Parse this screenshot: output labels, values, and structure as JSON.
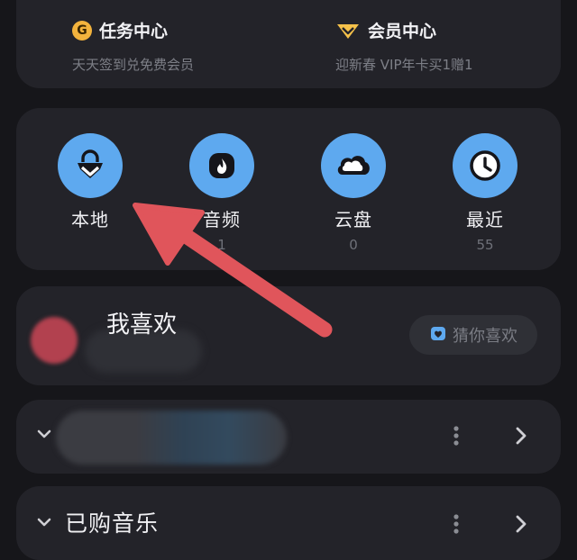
{
  "promos": [
    {
      "icon": "g-coin-icon",
      "title": "任务中心",
      "subtitle": "天天签到兑免费会员"
    },
    {
      "icon": "vip-diamond-icon",
      "title": "会员中心",
      "subtitle": "迎新春 VIP年卡买1赠1"
    }
  ],
  "quick_entries": [
    {
      "icon": "local-music-icon",
      "label": "本地",
      "count": ""
    },
    {
      "icon": "audio-flame-icon",
      "label": "音频",
      "count": "1"
    },
    {
      "icon": "cloud-disk-icon",
      "label": "云盘",
      "count": "0"
    },
    {
      "icon": "clock-icon",
      "label": "最近",
      "count": "55"
    }
  ],
  "favorites": {
    "title": "我喜欢",
    "guess_button": "猜你喜欢"
  },
  "playlists": [
    {
      "title": ""
    },
    {
      "title": "已购音乐"
    }
  ],
  "colors": {
    "background": "#16161a",
    "card": "#232329",
    "accent_blue": "#5ea9ef",
    "arrow_red": "#e0555b",
    "coin_gold": "#f3b33d"
  }
}
